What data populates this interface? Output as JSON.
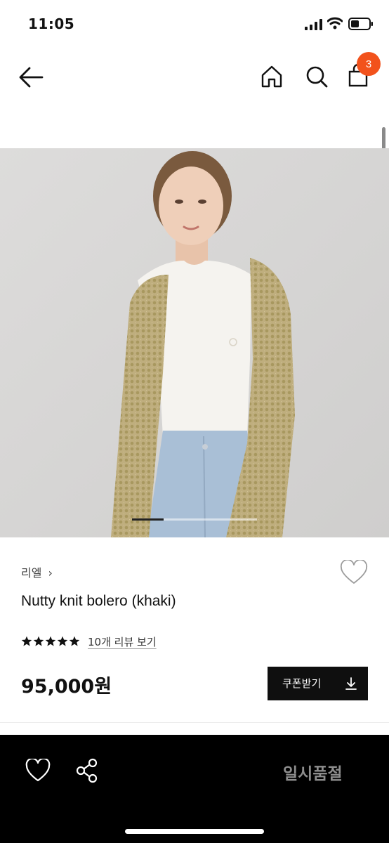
{
  "status_bar": {
    "time": "11:05"
  },
  "nav": {
    "icons": [
      "arrow-left-icon",
      "home-icon",
      "search-icon",
      "shopping-bag-icon"
    ],
    "cart_count": "3",
    "badge_color": "#f2521c"
  },
  "carousel": {
    "progress": 0.25
  },
  "product": {
    "brand": "리엘",
    "name": "Nutty knit bolero (khaki)",
    "rating": 5,
    "review_link": "10개 리뷰 보기",
    "price": "95,000원",
    "coupon_label": "쿠폰받기"
  },
  "bottom_bar": {
    "sold_out_label": "일시품절",
    "icons": [
      "heart-icon",
      "share-icon"
    ]
  },
  "colors": {
    "accent": "#f2521c",
    "primary_button": "#0f0f0f",
    "bottom_bar": "#000000",
    "sold_out_text": "#8d8d8d"
  }
}
